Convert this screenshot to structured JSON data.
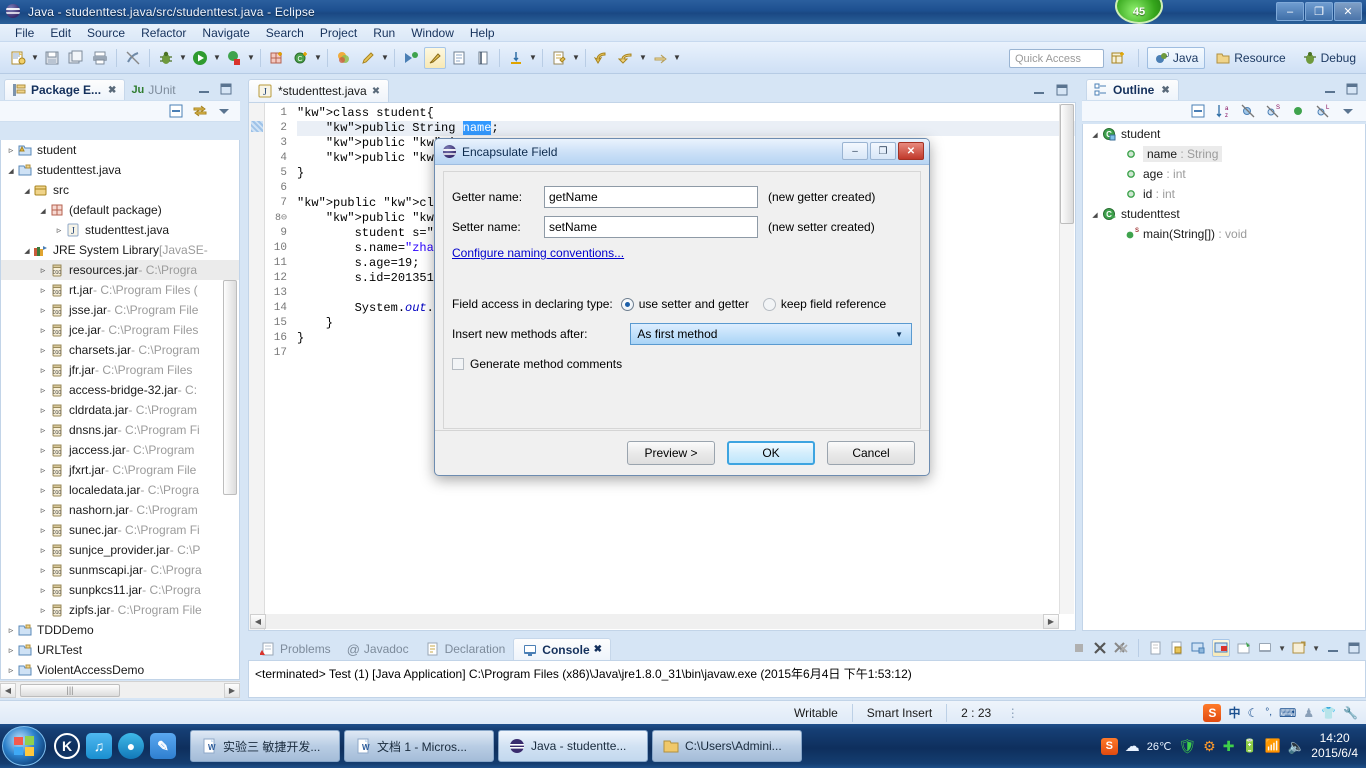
{
  "window": {
    "title": "Java - studenttest.java/src/studenttest.java - Eclipse",
    "badge": "45",
    "minimize": "–",
    "restore": "❐",
    "close": "✕"
  },
  "menubar": {
    "items": [
      "File",
      "Edit",
      "Source",
      "Refactor",
      "Navigate",
      "Search",
      "Project",
      "Run",
      "Window",
      "Help"
    ]
  },
  "toolbar": {
    "quick_access_placeholder": "Quick Access",
    "perspectives": [
      {
        "label": "Java",
        "selected": true
      },
      {
        "label": "Resource",
        "selected": false
      },
      {
        "label": "Debug",
        "selected": false
      }
    ]
  },
  "package_explorer": {
    "tabs": [
      {
        "label": "Package E...",
        "selected": true,
        "closable": true
      },
      {
        "label": "JUnit",
        "selected": false,
        "closable": false
      }
    ],
    "tree": [
      {
        "indent": 0,
        "twisty": "closed",
        "icon": "project-warning",
        "label": "student",
        "path": ""
      },
      {
        "indent": 0,
        "twisty": "open",
        "icon": "project",
        "label": "studenttest.java",
        "path": ""
      },
      {
        "indent": 1,
        "twisty": "open",
        "icon": "source-folder",
        "label": "src",
        "path": ""
      },
      {
        "indent": 2,
        "twisty": "open",
        "icon": "package",
        "label": "(default package)",
        "path": ""
      },
      {
        "indent": 3,
        "twisty": "closed",
        "icon": "java-file",
        "label": "studenttest.java",
        "path": ""
      },
      {
        "indent": 1,
        "twisty": "open",
        "icon": "library",
        "label": "JRE System Library",
        "path": " [JavaSE-"
      },
      {
        "indent": 2,
        "twisty": "closed",
        "icon": "jar",
        "label": "resources.jar",
        "path": " - C:\\Progra",
        "selected": true
      },
      {
        "indent": 2,
        "twisty": "closed",
        "icon": "jar",
        "label": "rt.jar",
        "path": " - C:\\Program Files ("
      },
      {
        "indent": 2,
        "twisty": "closed",
        "icon": "jar",
        "label": "jsse.jar",
        "path": " - C:\\Program File"
      },
      {
        "indent": 2,
        "twisty": "closed",
        "icon": "jar",
        "label": "jce.jar",
        "path": " - C:\\Program Files"
      },
      {
        "indent": 2,
        "twisty": "closed",
        "icon": "jar",
        "label": "charsets.jar",
        "path": " - C:\\Program"
      },
      {
        "indent": 2,
        "twisty": "closed",
        "icon": "jar",
        "label": "jfr.jar",
        "path": " - C:\\Program Files"
      },
      {
        "indent": 2,
        "twisty": "closed",
        "icon": "jar",
        "label": "access-bridge-32.jar",
        "path": " - C:"
      },
      {
        "indent": 2,
        "twisty": "closed",
        "icon": "jar",
        "label": "cldrdata.jar",
        "path": " - C:\\Program"
      },
      {
        "indent": 2,
        "twisty": "closed",
        "icon": "jar",
        "label": "dnsns.jar",
        "path": " - C:\\Program Fi"
      },
      {
        "indent": 2,
        "twisty": "closed",
        "icon": "jar",
        "label": "jaccess.jar",
        "path": " - C:\\Program"
      },
      {
        "indent": 2,
        "twisty": "closed",
        "icon": "jar",
        "label": "jfxrt.jar",
        "path": " - C:\\Program File"
      },
      {
        "indent": 2,
        "twisty": "closed",
        "icon": "jar",
        "label": "localedata.jar",
        "path": " - C:\\Progra"
      },
      {
        "indent": 2,
        "twisty": "closed",
        "icon": "jar",
        "label": "nashorn.jar",
        "path": " - C:\\Program"
      },
      {
        "indent": 2,
        "twisty": "closed",
        "icon": "jar",
        "label": "sunec.jar",
        "path": " - C:\\Program Fi"
      },
      {
        "indent": 2,
        "twisty": "closed",
        "icon": "jar",
        "label": "sunjce_provider.jar",
        "path": " - C:\\P"
      },
      {
        "indent": 2,
        "twisty": "closed",
        "icon": "jar",
        "label": "sunmscapi.jar",
        "path": " - C:\\Progra"
      },
      {
        "indent": 2,
        "twisty": "closed",
        "icon": "jar",
        "label": "sunpkcs11.jar",
        "path": " - C:\\Progra"
      },
      {
        "indent": 2,
        "twisty": "closed",
        "icon": "jar",
        "label": "zipfs.jar",
        "path": " - C:\\Program File"
      },
      {
        "indent": 0,
        "twisty": "closed",
        "icon": "project",
        "label": "TDDDemo",
        "path": ""
      },
      {
        "indent": 0,
        "twisty": "closed",
        "icon": "project",
        "label": "URLTest",
        "path": ""
      },
      {
        "indent": 0,
        "twisty": "closed",
        "icon": "project",
        "label": "ViolentAccessDemo",
        "path": ""
      }
    ]
  },
  "editor": {
    "tab_label": "*studenttest.java",
    "lines": [
      {
        "n": 1,
        "text": "class student{"
      },
      {
        "n": 2,
        "text": "    public String name;",
        "highlight": true
      },
      {
        "n": 3,
        "text": "    public int age;"
      },
      {
        "n": 4,
        "text": "    public int id;"
      },
      {
        "n": 5,
        "text": "}"
      },
      {
        "n": 6,
        "text": ""
      },
      {
        "n": 7,
        "text": "public class studenttest{"
      },
      {
        "n": 8,
        "text": "    public static void main(String[] args){"
      },
      {
        "n": 9,
        "text": "        student s=new student();"
      },
      {
        "n": 10,
        "text": "        s.name=\"zhang\";"
      },
      {
        "n": 11,
        "text": "        s.age=19;"
      },
      {
        "n": 12,
        "text": "        s.id=20135123;"
      },
      {
        "n": 13,
        "text": ""
      },
      {
        "n": 14,
        "text": "        System.out.println();"
      },
      {
        "n": 15,
        "text": "    }"
      },
      {
        "n": 16,
        "text": "}"
      },
      {
        "n": 17,
        "text": ""
      }
    ],
    "selected_token": "name"
  },
  "outline": {
    "tab_label": "Outline",
    "tree": [
      {
        "indent": 0,
        "twisty": "open",
        "icon": "class-default",
        "label": "student",
        "type": "",
        "selected": false
      },
      {
        "indent": 1,
        "twisty": "none",
        "icon": "field-public",
        "label": "name",
        "type": " : String",
        "selected": true
      },
      {
        "indent": 1,
        "twisty": "none",
        "icon": "field-public",
        "label": "age",
        "type": " : int",
        "selected": false
      },
      {
        "indent": 1,
        "twisty": "none",
        "icon": "field-public",
        "label": "id",
        "type": " : int",
        "selected": false
      },
      {
        "indent": 0,
        "twisty": "open",
        "icon": "class-public",
        "label": "studenttest",
        "type": "",
        "selected": false
      },
      {
        "indent": 1,
        "twisty": "none",
        "icon": "method-static",
        "label": "main(String[])",
        "type": " : void",
        "selected": false
      }
    ]
  },
  "console": {
    "tabs": [
      {
        "label": "Problems",
        "selected": false
      },
      {
        "label": "Javadoc",
        "selected": false
      },
      {
        "label": "Declaration",
        "selected": false
      },
      {
        "label": "Console",
        "selected": true
      }
    ],
    "output": "<terminated> Test (1) [Java Application] C:\\Program Files (x86)\\Java\\jre1.8.0_31\\bin\\javaw.exe (2015年6月4日 下午1:53:12)"
  },
  "statusbar": {
    "writable": "Writable",
    "insert_mode": "Smart Insert",
    "position": "2 : 23",
    "ime": "中"
  },
  "dialog": {
    "title": "Encapsulate Field",
    "getter_label": "Getter name:",
    "getter_value": "getName",
    "getter_hint": "(new getter created)",
    "setter_label": "Setter name:",
    "setter_value": "setName",
    "setter_hint": "(new setter created)",
    "link": "Configure naming conventions...",
    "access_label": "Field access in declaring type:",
    "access_option_1": "use setter and getter",
    "access_option_2": "keep field reference",
    "insert_label": "Insert new methods after:",
    "insert_value": "As first method",
    "comments_label": "Generate method comments",
    "buttons": {
      "preview": "Preview >",
      "ok": "OK",
      "cancel": "Cancel"
    },
    "window_buttons": {
      "minimize": "–",
      "restore": "❐",
      "close": "✕"
    }
  },
  "taskbar": {
    "tasks": [
      {
        "label": "实验三 敏捷开发...",
        "icon": "word",
        "active": false
      },
      {
        "label": "文档 1 - Micros...",
        "icon": "word",
        "active": false
      },
      {
        "label": "Java - studentte...",
        "icon": "eclipse",
        "active": true
      },
      {
        "label": "C:\\Users\\Admini...",
        "icon": "folder",
        "active": false
      }
    ],
    "temperature": "26℃",
    "clock_time": "14:20",
    "clock_date": "2015/6/4"
  },
  "colors": {
    "accent": "#3399ff",
    "title_blue": "#1d4f8f",
    "keyword": "#7f0055",
    "field": "#0000c0",
    "string": "#2a00ff",
    "link": "#0000cc"
  }
}
